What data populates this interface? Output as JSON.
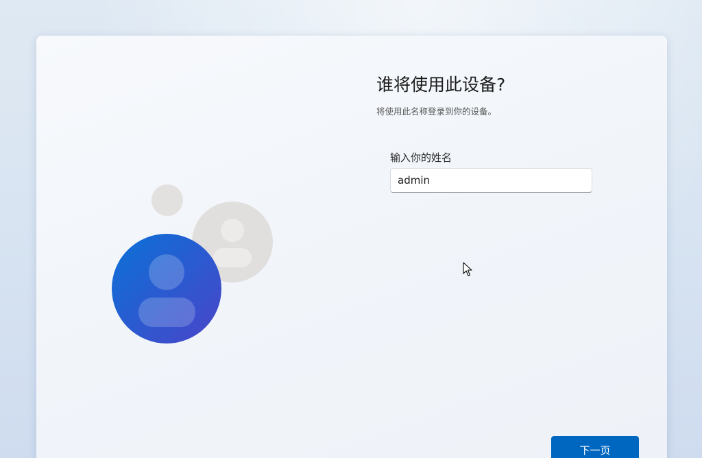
{
  "page": {
    "title": "谁将使用此设备?",
    "subtitle": "将使用此名称登录到你的设备。"
  },
  "form": {
    "name_label": "输入你的姓名",
    "name_value": "admin"
  },
  "actions": {
    "next_label": "下一页"
  },
  "illustration": {
    "icon": "users-icon",
    "primary_color": "#1f6fd6",
    "secondary_color": "#e0dedd"
  },
  "colors": {
    "accent": "#0067c0"
  }
}
